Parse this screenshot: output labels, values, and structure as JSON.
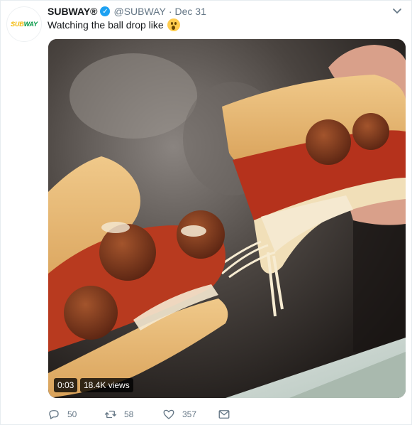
{
  "tweet": {
    "avatar": {
      "logo_sub": "SUB",
      "logo_way": "WAY"
    },
    "name": "SUBWAY®",
    "handle": "@SUBWAY",
    "separator": "·",
    "date": "Dec 31",
    "text": "Watching the ball drop like",
    "emoji": "hushed-face-emoji",
    "video": {
      "elapsed": "0:03",
      "views": "18.4K views"
    },
    "actions": {
      "replies": "50",
      "retweets": "58",
      "likes": "357"
    }
  }
}
